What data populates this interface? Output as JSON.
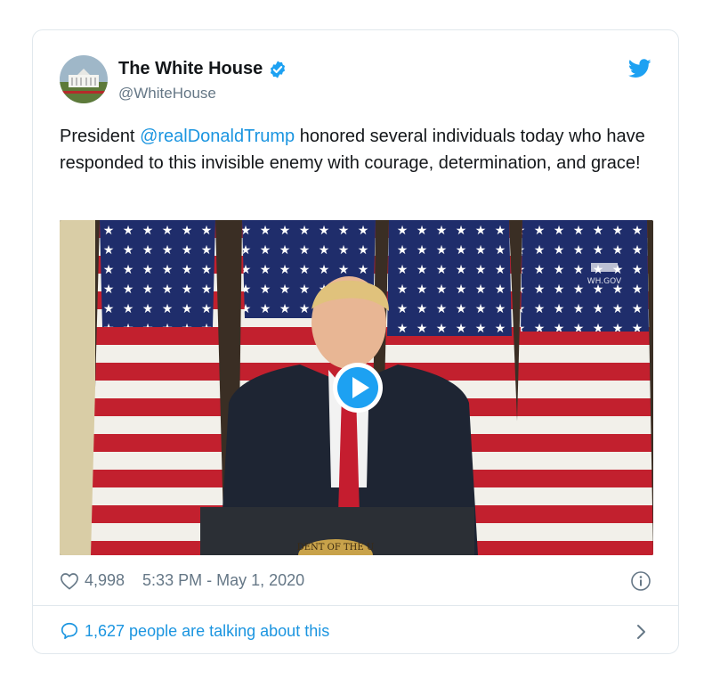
{
  "account": {
    "name": "The White House",
    "handle": "@WhiteHouse",
    "verified": true
  },
  "tweet": {
    "text_before": "President ",
    "mention": "@realDonaldTrump",
    "text_after": " honored several individuals today who have responded to this invisible enemy with courage, determination, and grace!"
  },
  "media": {
    "type": "video",
    "watermark": "WH.GOV",
    "seal_text": "DENT OF THE U"
  },
  "stats": {
    "likes": "4,998",
    "timestamp": "5:33 PM - May 1, 2020"
  },
  "conversation": {
    "label": "1,627 people are talking about this"
  },
  "colors": {
    "accent": "#1b95e0",
    "muted": "#657786",
    "border": "#e1e8ed"
  },
  "icons": [
    "verified-badge-icon",
    "twitter-bird-icon",
    "play-icon",
    "heart-icon",
    "info-icon",
    "reply-bubble-icon",
    "chevron-right-icon"
  ]
}
